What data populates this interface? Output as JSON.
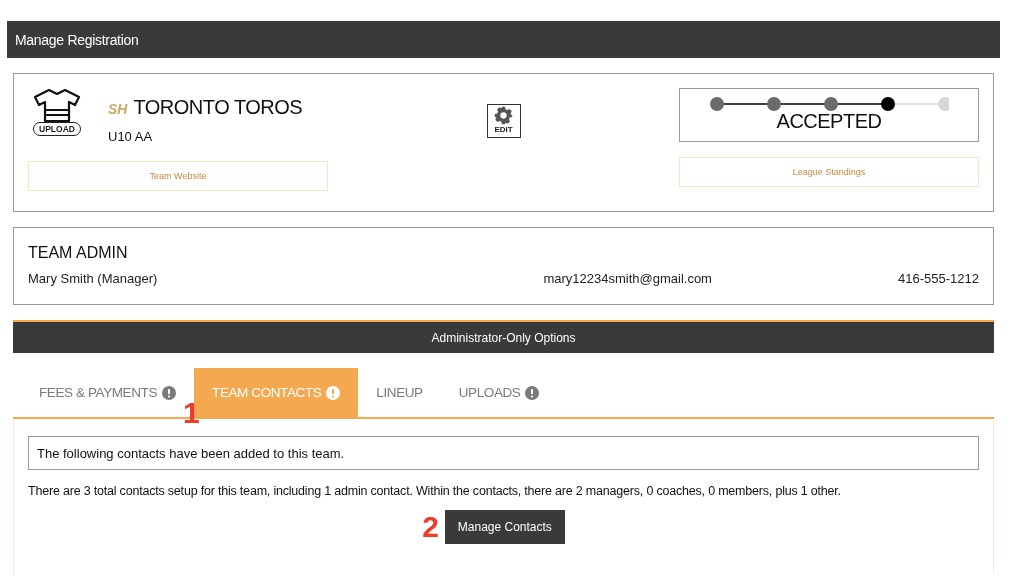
{
  "header": {
    "title": "Manage Registration"
  },
  "team": {
    "upload_label": "UPLOAD",
    "logo_text": "SH",
    "name": "TORONTO TOROS",
    "division": "U10 AA",
    "edit_label": "EDIT",
    "website_button": "Team Website",
    "standings_button": "League Standings",
    "status": {
      "label": "ACCEPTED",
      "steps": [
        {
          "completed": true,
          "current": false
        },
        {
          "completed": true,
          "current": false
        },
        {
          "completed": true,
          "current": false
        },
        {
          "completed": true,
          "current": true
        },
        {
          "completed": false,
          "current": false
        }
      ]
    }
  },
  "admin": {
    "title": "TEAM ADMIN",
    "name": "Mary Smith (Manager)",
    "email": "mary12234smith@gmail.com",
    "phone": "416-555-1212"
  },
  "admin_options": {
    "label": "Administrator-Only Options"
  },
  "tabs": [
    {
      "label": "FEES & PAYMENTS",
      "selected": false,
      "alert": true
    },
    {
      "label": "TEAM CONTACTS",
      "selected": true,
      "alert": true
    },
    {
      "label": "LINEUP",
      "selected": false,
      "alert": false
    },
    {
      "label": "UPLOADS",
      "selected": false,
      "alert": true
    }
  ],
  "contacts": {
    "notice": "The following contacts have been added to this team.",
    "summary": "There are 3 total contacts setup for this team, including 1 admin contact. Within the contacts, there are 2 managers, 0 coaches, 0 members, plus 1 other.",
    "button": "Manage Contacts"
  },
  "annotations": [
    "1",
    "2"
  ]
}
